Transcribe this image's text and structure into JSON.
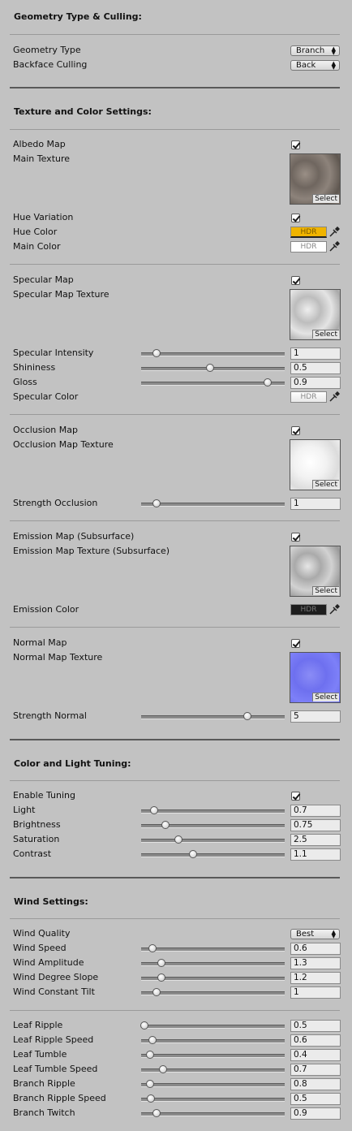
{
  "geometry": {
    "header": "Geometry Type & Culling:",
    "type_label": "Geometry Type",
    "type_value": "Branch",
    "culling_label": "Backface Culling",
    "culling_value": "Back"
  },
  "texture": {
    "header": "Texture and Color Settings:",
    "albedo_map_label": "Albedo Map",
    "albedo_map_checked": true,
    "main_texture_label": "Main Texture",
    "select_label": "Select",
    "hue_variation_label": "Hue Variation",
    "hue_color_label": "Hue Color",
    "hue_color_value": "#f0b400",
    "main_color_label": "Main Color",
    "main_color_value": "#ffffff",
    "hdr_label": "HDR",
    "specular_map_label": "Specular Map",
    "specular_texture_label": "Specular Map Texture",
    "specular_intensity_label": "Specular Intensity",
    "specular_intensity_value": "1",
    "shininess_label": "Shininess",
    "shininess_value": "0.5",
    "gloss_label": "Gloss",
    "gloss_value": "0.9",
    "specular_color_label": "Specular Color",
    "occlusion_map_label": "Occlusion Map",
    "occlusion_texture_label": "Occlusion Map Texture",
    "strength_occlusion_label": "Strength Occlusion",
    "strength_occlusion_value": "1",
    "emission_map_label": "Emission Map (Subsurface)",
    "emission_texture_label": "Emission Map Texture (Subsurface)",
    "emission_color_label": "Emission Color",
    "emission_color_value": "#1e1e1e",
    "normal_map_label": "Normal Map",
    "normal_texture_label": "Normal Map Texture",
    "strength_normal_label": "Strength Normal",
    "strength_normal_value": "5"
  },
  "tuning": {
    "header": "Color and Light Tuning:",
    "enable_label": "Enable Tuning",
    "light_label": "Light",
    "light_value": "0.7",
    "brightness_label": "Brightness",
    "brightness_value": "0.75",
    "saturation_label": "Saturation",
    "saturation_value": "2.5",
    "contrast_label": "Contrast",
    "contrast_value": "1.1"
  },
  "wind": {
    "header": "Wind Settings:",
    "quality_label": "Wind Quality",
    "quality_value": "Best",
    "speed_label": "Wind Speed",
    "speed_value": "0.6",
    "amplitude_label": "Wind Amplitude",
    "amplitude_value": "1.3",
    "degree_slope_label": "Wind Degree Slope",
    "degree_slope_value": "1.2",
    "constant_tilt_label": "Wind Constant Tilt",
    "constant_tilt_value": "1",
    "leaf_ripple_label": "Leaf Ripple",
    "leaf_ripple_value": "0.5",
    "leaf_ripple_speed_label": "Leaf Ripple Speed",
    "leaf_ripple_speed_value": "0.6",
    "leaf_tumble_label": "Leaf Tumble",
    "leaf_tumble_value": "0.4",
    "leaf_tumble_speed_label": "Leaf Tumble Speed",
    "leaf_tumble_speed_value": "0.7",
    "branch_ripple_label": "Branch Ripple",
    "branch_ripple_value": "0.8",
    "branch_ripple_speed_label": "Branch Ripple Speed",
    "branch_ripple_speed_value": "0.5",
    "branch_twitch_label": "Branch Twitch",
    "branch_twitch_value": "0.9"
  },
  "sliders": {
    "specular_intensity": 0.11,
    "shininess": 0.48,
    "gloss": 0.88,
    "strength_occlusion": 0.11,
    "strength_normal": 0.74,
    "light": 0.09,
    "brightness": 0.17,
    "saturation": 0.26,
    "contrast": 0.36,
    "wind_speed": 0.08,
    "wind_amplitude": 0.14,
    "wind_degree_slope": 0.14,
    "wind_constant_tilt": 0.11,
    "leaf_ripple": 0.02,
    "leaf_ripple_speed": 0.08,
    "leaf_tumble": 0.06,
    "leaf_tumble_speed": 0.15,
    "branch_ripple": 0.06,
    "branch_ripple_speed": 0.07,
    "branch_twitch": 0.11
  }
}
